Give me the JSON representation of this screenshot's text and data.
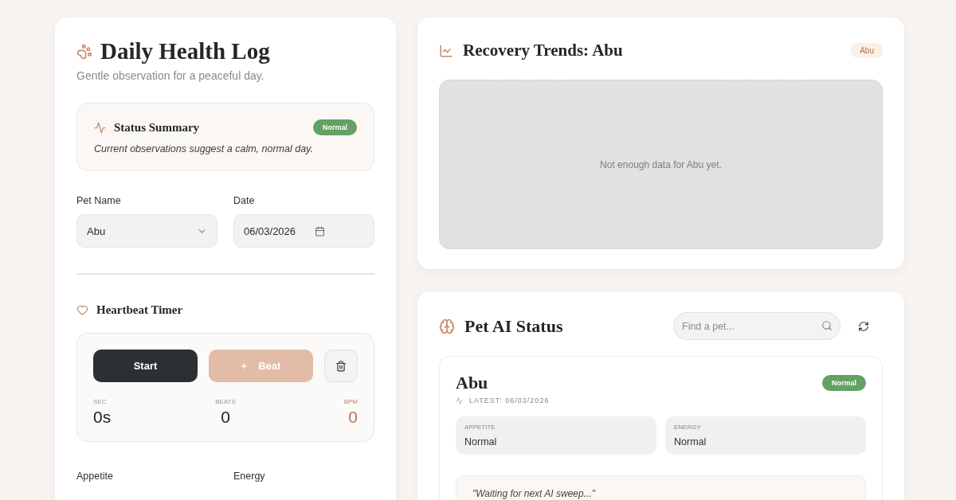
{
  "log": {
    "title": "Daily Health Log",
    "subtitle": "Gentle observation for a peaceful day.",
    "summary": {
      "title": "Status Summary",
      "badge": "Normal",
      "text": "Current observations suggest a calm, normal day."
    },
    "pet_name": {
      "label": "Pet Name",
      "value": "Abu"
    },
    "date": {
      "label": "Date",
      "value": "06/03/2026"
    },
    "heartbeat": {
      "title": "Heartbeat Timer",
      "start": "Start",
      "beat_icon": "+",
      "beat": "Beat",
      "beat_disabled": true,
      "stats": [
        {
          "label": "SEC",
          "value": "0s",
          "accent": false
        },
        {
          "label": "BEATS",
          "value": "0",
          "accent": false
        },
        {
          "label": "BPM",
          "value": "0",
          "accent": true
        }
      ]
    },
    "fields": [
      "Appetite",
      "Energy"
    ]
  },
  "trends": {
    "title": "Recovery Trends: Abu",
    "tag": "Abu",
    "empty": "Not enough data for Abu yet."
  },
  "ai": {
    "title": "Pet AI Status",
    "search_placeholder": "Find a pet...",
    "pet": {
      "name": "Abu",
      "badge": "Normal",
      "latest": "LATEST: 06/03/2026",
      "metrics": [
        {
          "label": "APPETITE",
          "value": "Normal"
        },
        {
          "label": "ENERGY",
          "value": "Normal"
        }
      ],
      "quote": "\"Waiting for next AI sweep...\""
    }
  }
}
